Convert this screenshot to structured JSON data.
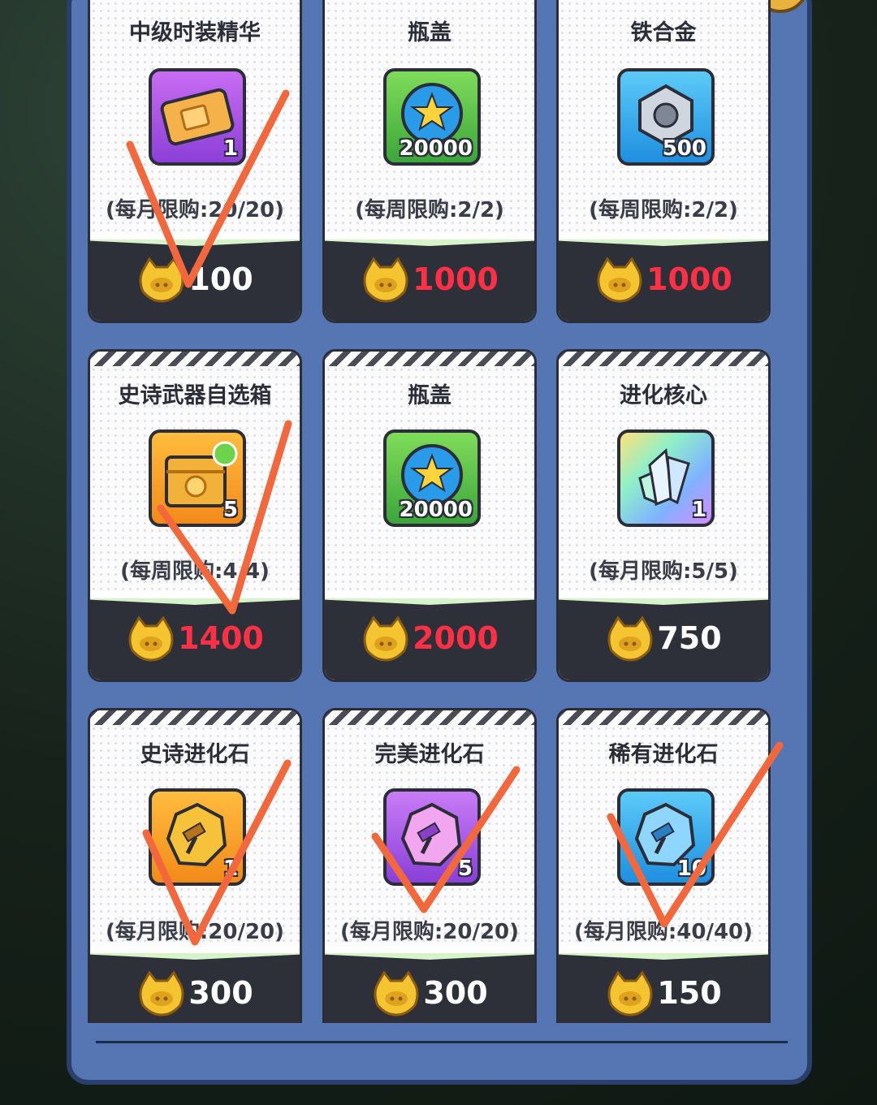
{
  "cards": [
    {
      "title": "中级时装精华",
      "qty": "1",
      "limit": "(每月限购:20/20)",
      "price": "100",
      "price_color": "#ff2f45",
      "tile": "purple",
      "icon": "ticket-icon"
    },
    {
      "title": "瓶盖",
      "qty": "20000",
      "limit": "(每周限购:2/2)",
      "price": "1000",
      "price_color": "#ff2f45",
      "tile": "green",
      "icon": "bottle-cap-icon"
    },
    {
      "title": "铁合金",
      "qty": "500",
      "limit": "(每周限购:2/2)",
      "price": "1000",
      "price_color": "#ff2f45",
      "tile": "blue",
      "icon": "hex-nut-icon"
    },
    {
      "title": "史诗武器自选箱",
      "qty": "5",
      "limit": "(每周限购:4/4)",
      "price": "1400",
      "price_color": "#ff2f45",
      "tile": "orange",
      "icon": "weapon-box-icon"
    },
    {
      "title": "瓶盖",
      "qty": "20000",
      "limit": "",
      "price": "2000",
      "price_color": "#ff2f45",
      "tile": "green",
      "icon": "bottle-cap-icon"
    },
    {
      "title": "进化核心",
      "qty": "1",
      "limit": "(每月限购:5/5)",
      "price": "750",
      "price_color": "#ffffff",
      "tile": "rainbow",
      "icon": "crystal-core-icon"
    },
    {
      "title": "史诗进化石",
      "qty": "1",
      "limit": "(每月限购:20/20)",
      "price": "300",
      "price_color": "#ffffff",
      "tile": "orange",
      "icon": "gold-stone-icon"
    },
    {
      "title": "完美进化石",
      "qty": "5",
      "limit": "(每月限购:20/20)",
      "price": "300",
      "price_color": "#ffffff",
      "tile": "violet",
      "icon": "purple-stone-icon"
    },
    {
      "title": "稀有进化石",
      "qty": "10",
      "limit": "(每月限购:40/40)",
      "price": "150",
      "price_color": "#ffffff",
      "tile": "blue",
      "icon": "blue-stone-icon"
    }
  ],
  "colors": {
    "panel": "#5675b3",
    "card_footer": "#2d3038",
    "price_red": "#ff2f45",
    "check_mark": "#f2683c"
  },
  "currency_icon": "coin-icon"
}
